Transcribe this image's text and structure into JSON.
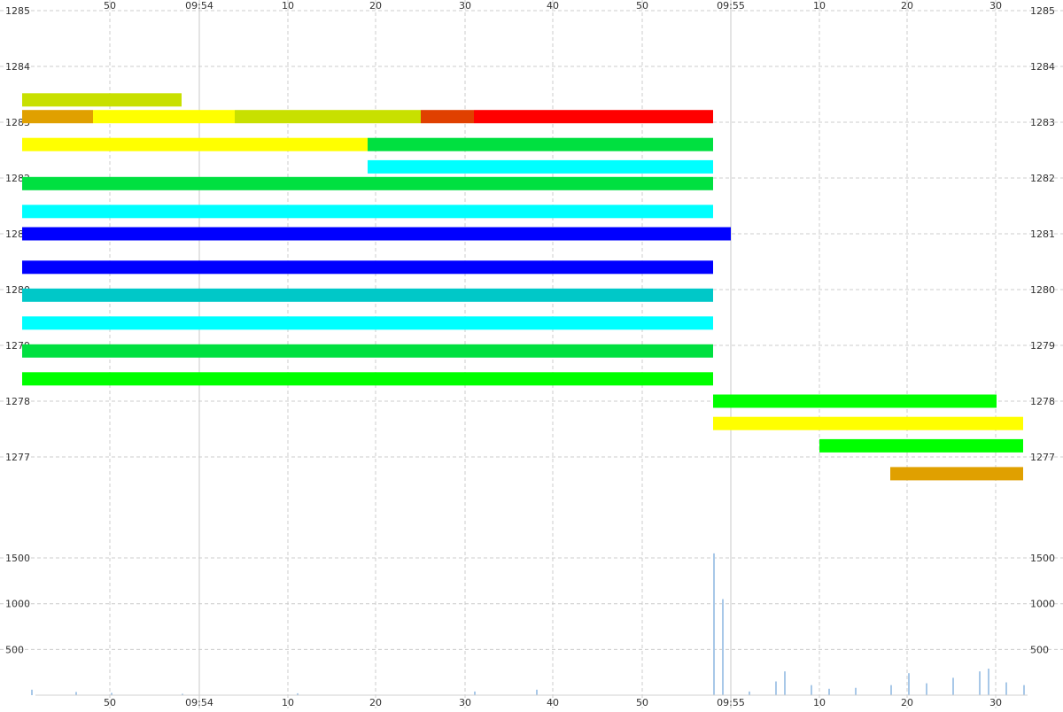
{
  "chart_data": [
    {
      "type": "heatmap",
      "title": "",
      "xlabel": "",
      "ylabel": "",
      "x_ticks": [
        "50",
        "09:54",
        "10",
        "20",
        "30",
        "40",
        "50",
        "09:55",
        "10",
        "20",
        "30"
      ],
      "y_ticks": [
        "1285",
        "1284",
        "1283",
        "1282",
        "1281",
        "1280",
        "1279",
        "1278",
        "1277"
      ],
      "ylim": [
        1276.0,
        1285.0
      ],
      "grid": true,
      "color_scale": [
        "#0000ff",
        "#00c8c8",
        "#00ffff",
        "#00e040",
        "#00ff00",
        "#a0e000",
        "#ffff00",
        "#e0a000",
        "#ff0000"
      ],
      "price_bands": [
        {
          "price": 1283.4,
          "from": "09:53:40",
          "to": "09:53:58",
          "color": "#c8e000"
        },
        {
          "price": 1283.1,
          "from": "09:53:40",
          "to": "09:53:48",
          "color": "#e0a000"
        },
        {
          "price": 1283.1,
          "from": "09:53:48",
          "to": "09:54:04",
          "color": "#ffff00"
        },
        {
          "price": 1283.1,
          "from": "09:54:04",
          "to": "09:54:25",
          "color": "#c8e000"
        },
        {
          "price": 1283.1,
          "from": "09:54:25",
          "to": "09:54:31",
          "color": "#e04000"
        },
        {
          "price": 1283.1,
          "from": "09:54:31",
          "to": "09:54:58",
          "color": "#ff0000"
        },
        {
          "price": 1282.6,
          "from": "09:53:40",
          "to": "09:54:19",
          "color": "#ffff00"
        },
        {
          "price": 1282.6,
          "from": "09:54:19",
          "to": "09:54:58",
          "color": "#00e040"
        },
        {
          "price": 1282.2,
          "from": "09:54:19",
          "to": "09:54:58",
          "color": "#00ffff"
        },
        {
          "price": 1281.9,
          "from": "09:53:40",
          "to": "09:54:58",
          "color": "#00e040"
        },
        {
          "price": 1281.4,
          "from": "09:53:40",
          "to": "09:54:58",
          "color": "#00ffff"
        },
        {
          "price": 1281.0,
          "from": "09:53:40",
          "to": "09:55:00",
          "color": "#0000ff"
        },
        {
          "price": 1280.4,
          "from": "09:53:40",
          "to": "09:54:58",
          "color": "#0000ff"
        },
        {
          "price": 1279.9,
          "from": "09:53:40",
          "to": "09:54:58",
          "color": "#00c8c8"
        },
        {
          "price": 1279.4,
          "from": "09:53:40",
          "to": "09:54:58",
          "color": "#00ffff"
        },
        {
          "price": 1278.9,
          "from": "09:53:40",
          "to": "09:54:58",
          "color": "#00e040"
        },
        {
          "price": 1278.4,
          "from": "09:53:40",
          "to": "09:54:58",
          "color": "#00ff00"
        },
        {
          "price": 1278.0,
          "from": "09:54:58",
          "to": "09:55:30",
          "color": "#00ff00"
        },
        {
          "price": 1277.6,
          "from": "09:54:58",
          "to": "09:55:33",
          "color": "#ffff00"
        },
        {
          "price": 1277.2,
          "from": "09:55:10",
          "to": "09:55:33",
          "color": "#00ff00"
        },
        {
          "price": 1276.7,
          "from": "09:55:18",
          "to": "09:55:33",
          "color": "#e0a000"
        }
      ]
    },
    {
      "type": "bar",
      "title": "",
      "xlabel": "",
      "ylabel": "",
      "x_ticks": [
        "50",
        "09:54",
        "10",
        "20",
        "30",
        "40",
        "50",
        "09:55",
        "10",
        "20",
        "30"
      ],
      "y_ticks": [
        "1500",
        "1000",
        "500"
      ],
      "ylim": [
        0,
        1620
      ],
      "grid": true,
      "bar_color": "#a8c8e8",
      "bars": [
        {
          "time": "09:53:41",
          "value": 60
        },
        {
          "time": "09:53:46",
          "value": 35
        },
        {
          "time": "09:53:50",
          "value": 25
        },
        {
          "time": "09:53:58",
          "value": 15
        },
        {
          "time": "09:54:11",
          "value": 20
        },
        {
          "time": "09:54:31",
          "value": 40
        },
        {
          "time": "09:54:38",
          "value": 60
        },
        {
          "time": "09:54:58",
          "value": 1550
        },
        {
          "time": "09:54:59",
          "value": 1050
        },
        {
          "time": "09:55:02",
          "value": 40
        },
        {
          "time": "09:55:05",
          "value": 150
        },
        {
          "time": "09:55:06",
          "value": 260
        },
        {
          "time": "09:55:09",
          "value": 110
        },
        {
          "time": "09:55:11",
          "value": 70
        },
        {
          "time": "09:55:14",
          "value": 80
        },
        {
          "time": "09:55:18",
          "value": 110
        },
        {
          "time": "09:55:20",
          "value": 240
        },
        {
          "time": "09:55:22",
          "value": 130
        },
        {
          "time": "09:55:25",
          "value": 190
        },
        {
          "time": "09:55:28",
          "value": 260
        },
        {
          "time": "09:55:29",
          "value": 290
        },
        {
          "time": "09:55:31",
          "value": 140
        },
        {
          "time": "09:55:33",
          "value": 110
        }
      ]
    }
  ]
}
